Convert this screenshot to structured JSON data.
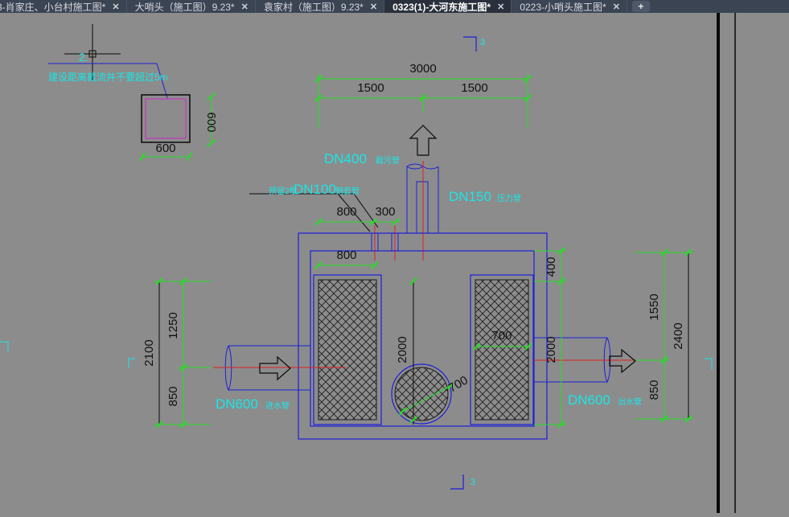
{
  "tabs": [
    {
      "label": "3-肖家庄、小台村施工图*",
      "active": false
    },
    {
      "label": "大哨头（施工图）9.23*",
      "active": false
    },
    {
      "label": "袁家村（施工图）9.23*",
      "active": false
    },
    {
      "label": "0323(1)-大河东施工图*",
      "active": true
    },
    {
      "label": "0223-小哨头施工图*",
      "active": false
    }
  ],
  "tab_close_glyph": "✕",
  "tab_add_glyph": "+",
  "drawing": {
    "dims": {
      "d3000": "3000",
      "d1500a": "1500",
      "d1500b": "1500",
      "d600h": "600",
      "d600v": "600",
      "d800a": "800",
      "d300": "300",
      "d800b": "800",
      "d400": "400",
      "d2100": "2100",
      "d1250": "1250",
      "d850a": "850",
      "d2000a": "2000",
      "d700a": "700",
      "d700b": "700",
      "d2000b": "2000",
      "d1550": "1550",
      "d2400": "2400",
      "d850b": "850"
    },
    "labels": {
      "small_box_note": "2.",
      "small_box_note2": "建设距离截流井不要超过5m",
      "dn400": "DN400",
      "dn400_suffix": "截污管",
      "dn150": "DN150",
      "dn150_suffix": "压力管",
      "dn100_prefix": "预留2根",
      "dn100": "DN100",
      "dn100_suffix": "钢套管",
      "dn600_in": "DN600",
      "dn600_in_suffix": "进水管",
      "dn600_out": "DN600",
      "dn600_out_suffix": "出水管",
      "sec_top": "3",
      "sec_bottom": "3"
    },
    "colors": {
      "canvas_bg": "#8c8c8c",
      "outline": "#1d1fd9",
      "dimension": "#22e022",
      "dim_text": "#111111",
      "label_text": "#19e6e6",
      "center_line": "#e02020",
      "hatch": "#1a1a1a"
    }
  }
}
